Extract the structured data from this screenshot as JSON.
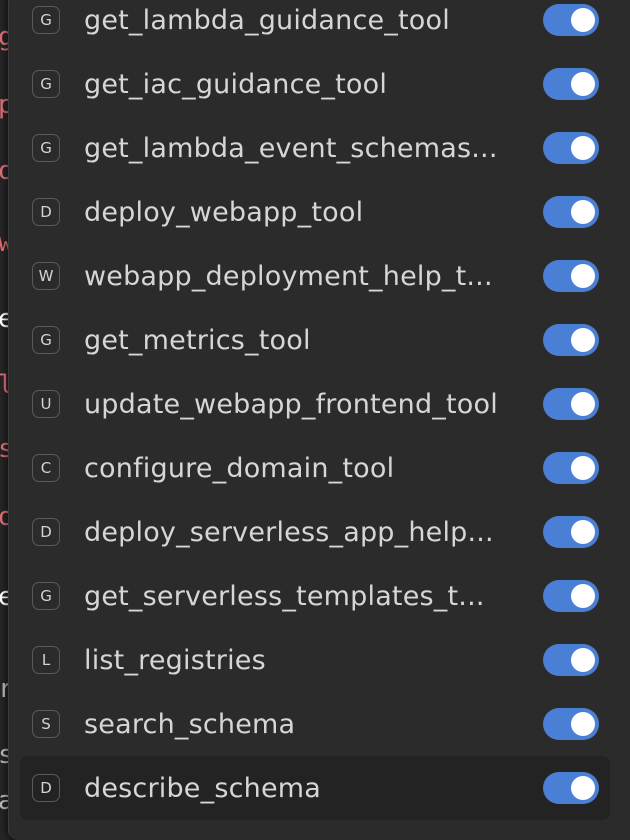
{
  "background_fragments": [
    {
      "text": "g",
      "color": "#e06c75"
    },
    {
      "text": "p",
      "color": "#e06c75"
    },
    {
      "text": "o",
      "color": "#e06c75"
    },
    {
      "text": "w",
      "color": "#e06c75"
    },
    {
      "text": "e",
      "color": "#ffffff"
    },
    {
      "text": "l",
      "color": "#e06c75"
    },
    {
      "text": "s",
      "color": "#e06c75"
    },
    {
      "text": "o",
      "color": "#e06c75"
    },
    {
      "text": "e",
      "color": "#ffffff"
    },
    {
      "text": "r",
      "color": "#bbbbbb"
    },
    {
      "text": "s",
      "color": "#bbbbbb"
    },
    {
      "text": "a",
      "color": "#bbbbbb"
    }
  ],
  "accent_color": "#4a7fd6",
  "tools": [
    {
      "badge": "G",
      "name": "get_lambda_guidance_tool",
      "enabled": true
    },
    {
      "badge": "G",
      "name": "get_iac_guidance_tool",
      "enabled": true
    },
    {
      "badge": "G",
      "name": "get_lambda_event_schemas...",
      "enabled": true
    },
    {
      "badge": "D",
      "name": "deploy_webapp_tool",
      "enabled": true
    },
    {
      "badge": "W",
      "name": "webapp_deployment_help_t...",
      "enabled": true
    },
    {
      "badge": "G",
      "name": "get_metrics_tool",
      "enabled": true
    },
    {
      "badge": "U",
      "name": "update_webapp_frontend_tool",
      "enabled": true
    },
    {
      "badge": "C",
      "name": "configure_domain_tool",
      "enabled": true
    },
    {
      "badge": "D",
      "name": "deploy_serverless_app_help...",
      "enabled": true
    },
    {
      "badge": "G",
      "name": "get_serverless_templates_t...",
      "enabled": true
    },
    {
      "badge": "L",
      "name": "list_registries",
      "enabled": true
    },
    {
      "badge": "S",
      "name": "search_schema",
      "enabled": true
    },
    {
      "badge": "D",
      "name": "describe_schema",
      "enabled": true
    }
  ]
}
